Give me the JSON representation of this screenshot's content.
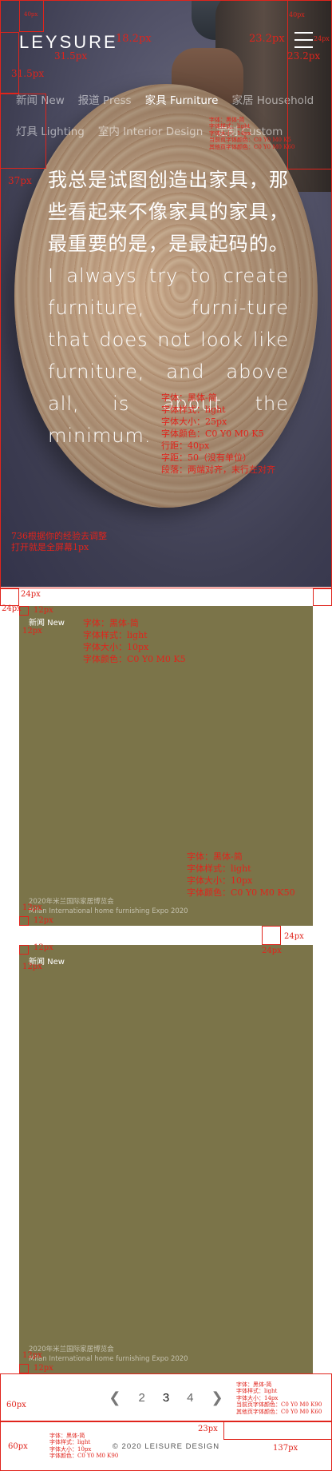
{
  "header": {
    "logo": "LEYSURE",
    "menu_icon": "hamburger-icon"
  },
  "nav": {
    "row1": [
      {
        "label": "新闻 New",
        "active": false
      },
      {
        "label": "报道 Press",
        "active": false
      },
      {
        "label": "家具 Furniture",
        "active": true
      },
      {
        "label": "家居 Household",
        "active": false
      }
    ],
    "row2": [
      {
        "label": "灯具 Lighting"
      },
      {
        "label": "室内 Interior Design"
      },
      {
        "label": "定制 Custom"
      }
    ]
  },
  "hero": {
    "quote": "我总是试图创造出家具，那些看起来不像家具的家具，最重要的是，是最起码的。I always try to create furniture, furni-ture that does not look like furniture, and above all, is about the minimum."
  },
  "cards": [
    {
      "tag": "新闻 New",
      "caption_cn": "2020年米兰国际家居博览会",
      "caption_en": "Milan International home furnishing Expo 2020"
    },
    {
      "tag": "新闻 New",
      "caption_cn": "2020年米兰国际家居博览会",
      "caption_en": "Milan International home furnishing Expo 2020"
    }
  ],
  "pagination": {
    "prev_icon": "chevron-left-icon",
    "pages": [
      "2",
      "3",
      "4"
    ],
    "current": "3",
    "next_icon": "chevron-right-icon"
  },
  "footer": {
    "copyright": "© 2020 LEISURE DESIGN"
  },
  "annotations": {
    "nav_spec": [
      "字体：黑体-简",
      "字体样式：light",
      "字体大小：14px",
      "当前页字体颜色：C0 Y0 M0 K5",
      "其他页字体颜色：C0 Y0 M0 K60"
    ],
    "quote_spec": [
      "字体：黑体-简",
      "字体样式：light",
      "字体大小：25px",
      "字体颜色：C0 Y0 M0 K5",
      "行距：40px",
      "字距：50（没有单位）",
      "段落：两端对齐，末行左对齐"
    ],
    "hero_note": [
      "736根据你的经验去调整",
      "打开就是全屏幕1px"
    ],
    "tag_spec": [
      "字体：黑体-简",
      "字体样式：light",
      "字体大小：10px",
      "字体颜色：C0 Y0 M0 K5"
    ],
    "caption_spec": [
      "字体：黑体-简",
      "字体样式：light",
      "字体大小：10px",
      "字体颜色：C0 Y0 M0 K50"
    ],
    "pager_spec": [
      "字体：黑体-简",
      "字体样式：light",
      "字体大小：14px",
      "当前页字体颜色：C0 Y0 M0 K90",
      "其他页字体颜色：C0 Y0 M0 K60"
    ],
    "footer_spec": [
      "字体：黑体-简",
      "字体样式：light",
      "字体大小：10px",
      "字体颜色：C0 Y0 M0 K90"
    ],
    "dims": {
      "d1": "40px",
      "d2": "18.2px",
      "d3": "23.2px",
      "d4": "40px",
      "d5": "24px",
      "d6": "23.2px",
      "d7": "31.5px",
      "d8": "37px",
      "d9": "24px",
      "d10": "24px",
      "d11": "12px",
      "d12": "12px",
      "d13": "12px",
      "d14": "12px",
      "d15": "24px",
      "d16": "24px",
      "d17": "12px",
      "d18": "12px",
      "d19": "12px",
      "d20": "12px",
      "d21": "60px",
      "d22": "60px",
      "d23": "23px",
      "d24": "137px",
      "d25": "31.5px"
    }
  }
}
